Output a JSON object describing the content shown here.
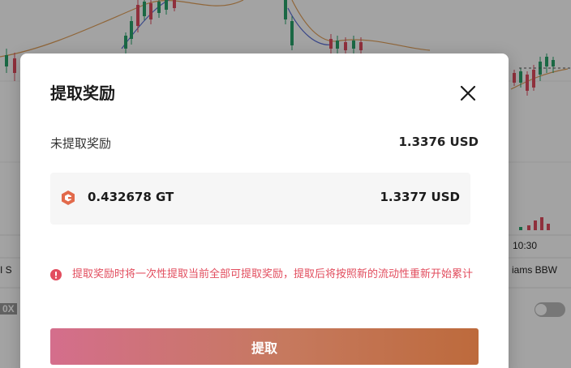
{
  "background": {
    "time_label": "10:30",
    "indicator_label": "iams BBW",
    "left_edge_label": "I S",
    "left_badge": "0X"
  },
  "modal": {
    "title": "提取奖励",
    "close_icon": "close-icon",
    "unclaimed_label": "未提取奖励",
    "unclaimed_value": "1.3376 USD",
    "token": {
      "icon": "gt-token-icon",
      "amount": "0.432678 GT",
      "usd_value": "1.3377 USD"
    },
    "warning": {
      "icon": "warning-icon",
      "text": "提取奖励时将一次性提取当前全部可提取奖励，提取后将按照新的流动性重新开始累计"
    },
    "claim_button_label": "提取"
  },
  "colors": {
    "warning": "#e24d5e",
    "button_gradient_start": "#d46e8c",
    "button_gradient_end": "#bd6a3c",
    "gt_icon": "#e26a4b"
  }
}
